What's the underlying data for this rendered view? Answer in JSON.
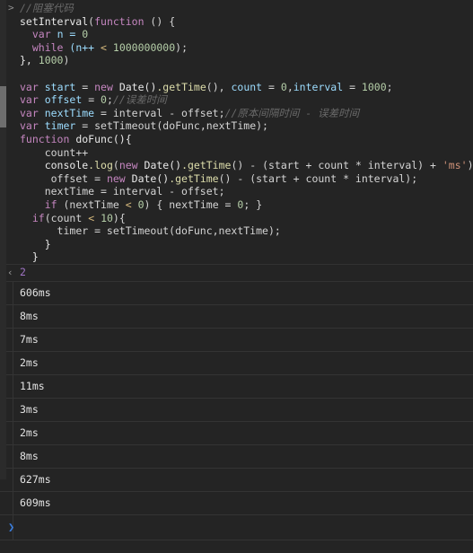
{
  "console": {
    "input_prompt_glyph": ">",
    "return_arrow_glyph": "‹",
    "bottom_prompt_glyph": "❯",
    "returned_value": "2",
    "colors": {
      "background": "#242424",
      "keyword": "#c586c0",
      "function": "#dcdcaa",
      "identifier": "#9cdcfe",
      "number": "#b5cea8",
      "string": "#ce9178",
      "comment": "#6a6a6a",
      "operator": "#d7ba7d",
      "prompt_blue": "#3b7fe0",
      "return_value_purple": "#a074c4",
      "row_separator": "#343434",
      "scrollbar_thumb": "#6e6e6e"
    },
    "code": {
      "line01_comment": "//阻塞代码",
      "line02_a": "setInterval",
      "line02_b": "(",
      "line02_c": "function",
      "line02_d": " () {",
      "line03_a": "var",
      "line03_b": " n = ",
      "line03_c": "0",
      "line04_a": "while",
      "line04_b": " (n++ ",
      "line04_c": "<",
      "line04_d": " ",
      "line04_e": "1000000000",
      "line04_f": ");",
      "line05": "}, ",
      "line05_num": "1000",
      "line05_end": ")",
      "line07_a": "var",
      "line07_b": "start",
      "line07_c": " = ",
      "line07_d": "new",
      "line07_e": " Date()",
      "line07_f": ".getTime",
      "line07_g": "(), ",
      "line07_h": "count",
      "line07_i": " = ",
      "line07_j": "0",
      "line07_k": ",",
      "line07_l": "interval",
      "line07_m": " = ",
      "line07_n": "1000",
      "line07_o": ";",
      "line08_a": "var",
      "line08_b": "offset",
      "line08_c": " = ",
      "line08_d": "0",
      "line08_e": ";",
      "line08_f": "//误差时间",
      "line09_a": "var",
      "line09_b": "nextTime",
      "line09_c": " = interval - offset;",
      "line09_d": "//原本间隔时间 - 误差时间",
      "line10_a": "var",
      "line10_b": "timer",
      "line10_c": " = setTimeout(doFunc,nextTime);",
      "line11_a": "function",
      "line11_b": " doFunc(){",
      "line12": "count++",
      "line13_a": "console",
      "line13_b": ".log",
      "line13_c": "(",
      "line13_d": "new",
      "line13_e": " Date()",
      "line13_f": ".getTime",
      "line13_g": "() - (start + count * interval) + ",
      "line13_h": "'ms'",
      "line13_i": ");",
      "line14_a": " offset = ",
      "line14_b": "new",
      "line14_c": " Date()",
      "line14_d": ".getTime",
      "line14_e": "() - (start + count * interval);",
      "line15": "nextTime = interval - offset;",
      "line16_a": "if",
      "line16_b": " (nextTime ",
      "line16_c": "<",
      "line16_d": " ",
      "line16_e": "0",
      "line16_f": ") { nextTime = ",
      "line16_g": "0",
      "line16_h": "; }",
      "line17_a": "if",
      "line17_b": "(count ",
      "line17_c": "<",
      "line17_d": " ",
      "line17_e": "10",
      "line17_f": "){",
      "line18": "timer = setTimeout(doFunc,nextTime);",
      "line19": "}",
      "line20": "}"
    },
    "log_output": [
      "606ms",
      "8ms",
      "7ms",
      "2ms",
      "11ms",
      "3ms",
      "2ms",
      "8ms",
      "627ms",
      "609ms"
    ]
  }
}
